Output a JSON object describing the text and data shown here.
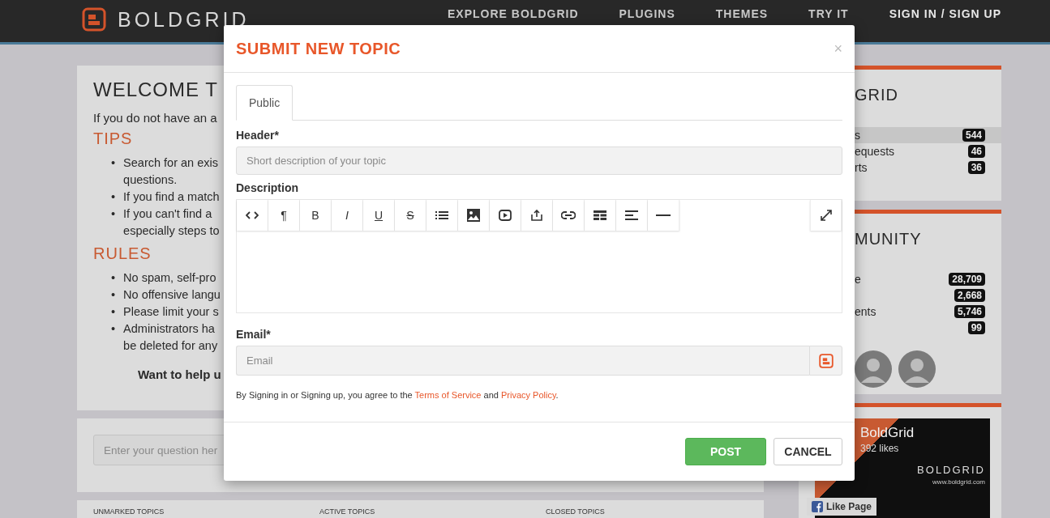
{
  "header": {
    "logo": "BOLDGRID",
    "nav": [
      {
        "label": "EXPLORE BOLDGRID"
      },
      {
        "label": "PLUGINS"
      },
      {
        "label": "THEMES"
      },
      {
        "label": "TRY IT"
      },
      {
        "label": "SIGN IN / SIGN UP"
      }
    ]
  },
  "welcome": {
    "title": "WELCOME T",
    "intro": "If you do not have an a",
    "sections": [
      {
        "heading": "TIPS",
        "items": [
          {
            "marker": "•",
            "lines": [
              "Search for an exis",
              "questions."
            ]
          },
          {
            "marker": "•",
            "lines": [
              "If you find a match"
            ]
          },
          {
            "marker": "•",
            "lines": [
              "If you can't find a",
              "especially steps to"
            ]
          }
        ]
      },
      {
        "heading": "RULES",
        "items": [
          {
            "marker": "•",
            "lines": [
              "No spam, self-pro"
            ]
          },
          {
            "marker": "•",
            "lines": [
              "No offensive langu"
            ]
          },
          {
            "marker": "•",
            "lines": [
              "Please limit your s"
            ]
          },
          {
            "marker": "•",
            "lines": [
              "Administrators ha",
              "be deleted for any"
            ]
          }
        ]
      }
    ],
    "closing": "Want to help u"
  },
  "question_search": {
    "placeholder": "Enter your question her"
  },
  "topic_tabs": [
    "UNMARKED TOPICS",
    "ACTIVE TOPICS",
    "CLOSED TOPICS"
  ],
  "sidebar": [
    {
      "title": "GRID",
      "rows": [
        {
          "label": "s",
          "count": "544",
          "selected": true
        },
        {
          "label": "equests",
          "count": "46",
          "selected": false
        },
        {
          "label": "rts",
          "count": "36",
          "selected": false
        }
      ]
    },
    {
      "title": "MUNITY",
      "rows": [
        {
          "label": "e",
          "count": "28,709",
          "selected": false
        },
        {
          "label": "",
          "count": "2,668",
          "selected": false
        },
        {
          "label": "ents",
          "count": "5,746",
          "selected": false
        },
        {
          "label": "",
          "count": "99",
          "selected": false
        }
      ],
      "avatars": [
        {
          "kind": "photo"
        },
        {
          "kind": "photo"
        }
      ]
    }
  ],
  "facebook": {
    "name": "BoldGrid",
    "likes": "392 likes",
    "brand": "BOLDGRID",
    "url": "www.boldgrid.com",
    "button": "Like Page"
  },
  "modal": {
    "title": "SUBMIT NEW TOPIC",
    "close": "×",
    "tabs": [
      {
        "label": "Public",
        "selected": true
      }
    ],
    "header_label": "Header*",
    "header_placeholder": "Short description of your topic",
    "description_label": "Description",
    "toolbar": [
      {
        "kind": "code"
      },
      {
        "kind": "text",
        "label": "¶"
      },
      {
        "kind": "bold",
        "label": "B"
      },
      {
        "kind": "italic",
        "label": "I"
      },
      {
        "kind": "underline",
        "label": "U"
      },
      {
        "kind": "strike",
        "label": "S"
      },
      {
        "kind": "list"
      },
      {
        "kind": "image"
      },
      {
        "kind": "video"
      },
      {
        "kind": "upload"
      },
      {
        "kind": "link"
      },
      {
        "kind": "table"
      },
      {
        "kind": "align"
      },
      {
        "kind": "rule"
      }
    ],
    "email_label": "Email*",
    "email_placeholder": "Email",
    "terms": {
      "before": "By Signing in or Signing up, you agree to the",
      "link1": "Terms of Service",
      "middle": "and",
      "link2": "Privacy Policy",
      "after": "."
    },
    "buttons": [
      {
        "label": "POST",
        "kind": "primary"
      },
      {
        "label": "CANCEL",
        "kind": "secondary"
      }
    ]
  }
}
